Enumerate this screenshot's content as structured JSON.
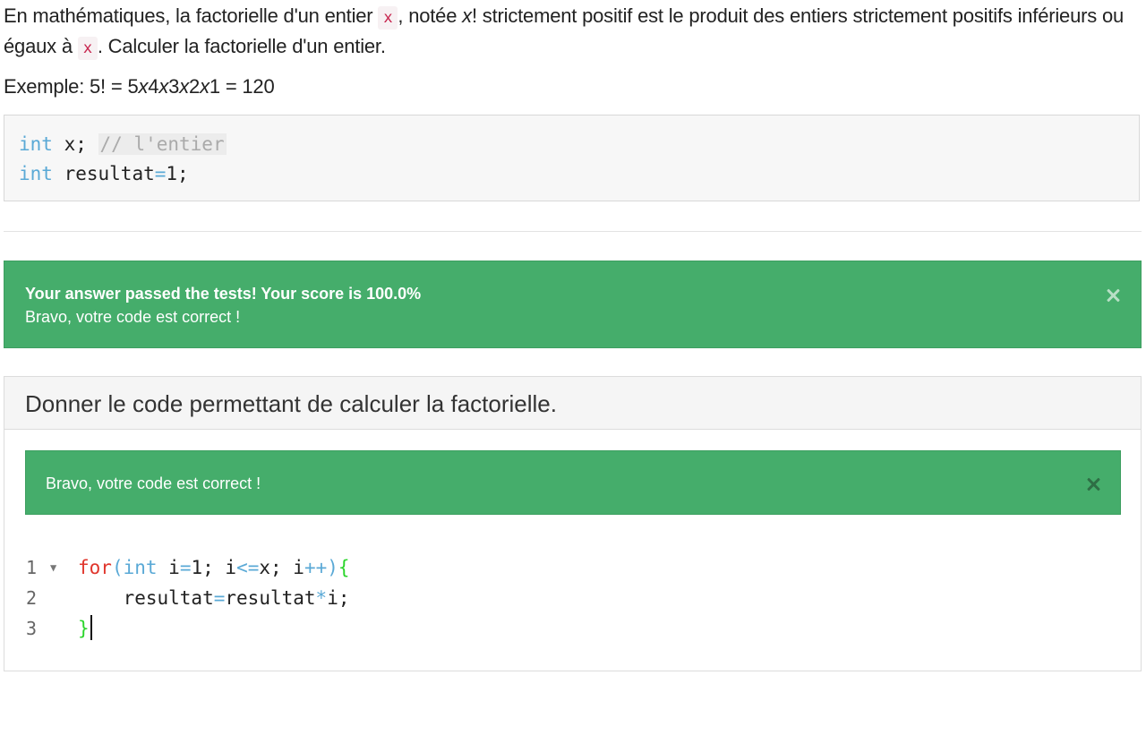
{
  "intro": {
    "part1": "En mathématiques, la factorielle d'un entier ",
    "var1": "x",
    "part2": ", notée ",
    "var_italic": "x",
    "part3": "! strictement positif est le produit des entiers strictement positifs inférieurs ou égaux à ",
    "var2": "x",
    "part4": ". Calculer la factorielle d'un entier."
  },
  "example": {
    "prefix": "Exemple: 5! = 5",
    "x1": "x",
    "n4": "4",
    "x2": "x",
    "n3": "3",
    "x3": "x",
    "n2": "2",
    "x4": "x",
    "suffix": "1 = 120"
  },
  "given_code": {
    "line1": {
      "kw": "int",
      "ident": " x; ",
      "comment": "// l'entier"
    },
    "line2": {
      "kw": "int",
      "ident": " resultat",
      "op": "=",
      "value": "1;"
    }
  },
  "result_alert": {
    "title": "Your answer passed the tests! Your score is 100.0%",
    "message": "Bravo, votre code est correct !",
    "close_glyph": "×"
  },
  "question_panel": {
    "heading": "Donner le code permettant de calculer la factorielle.",
    "feedback": "Bravo, votre code est correct !"
  },
  "editor": {
    "lines": [
      {
        "number": "1",
        "fold": "▼"
      },
      {
        "number": "2"
      },
      {
        "number": "3"
      }
    ],
    "l1": {
      "for": "for",
      "p1": "(",
      "int": "int",
      "a": " i",
      "eq": "=",
      "b": "1; i",
      "le": "<=",
      "c": "x; i",
      "inc": "++",
      "p2": ")",
      "brace": "{"
    },
    "l2": {
      "indent": "    ",
      "a": "resultat",
      "eq": "=",
      "b": "resultat",
      "mul": "*",
      "c": "i;"
    },
    "l3": {
      "brace": "}"
    }
  },
  "colors": {
    "success_green": "#45ad6b",
    "keyword_red": "#e0362c",
    "type_blue": "#5aa9d6",
    "brace_green": "#2bd52b",
    "inline_code": "#c7254e"
  }
}
